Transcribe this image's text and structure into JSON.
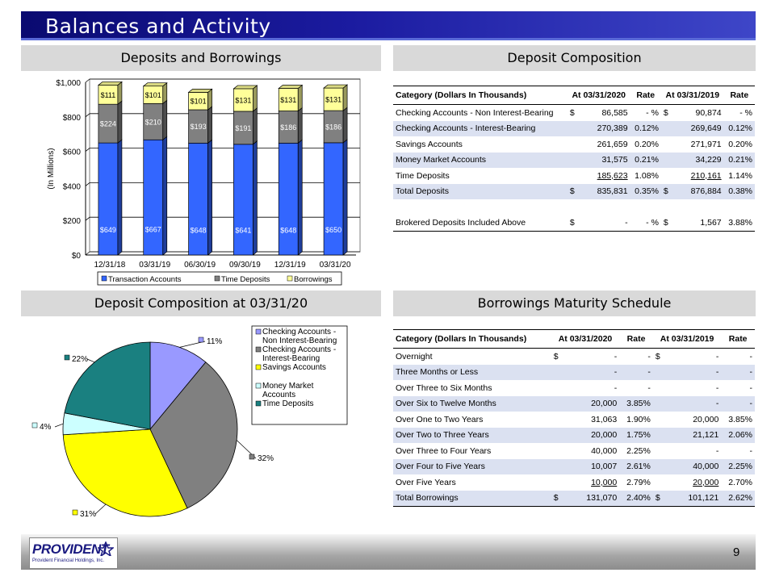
{
  "page": {
    "title": "Balances and Activity",
    "page_number": "9",
    "logo_text": "PROVIDENT",
    "logo_subtext": "Provident Financial Holdings, Inc."
  },
  "sections": {
    "deposits_borrowings": "Deposits and Borrowings",
    "deposit_composition": "Deposit Composition",
    "deposit_composition_pie": "Deposit Composition at 03/31/20",
    "borrowings_schedule": "Borrowings Maturity Schedule"
  },
  "chart_data": [
    {
      "type": "bar",
      "stacked": true,
      "categories": [
        "12/31/18",
        "03/31/19",
        "06/30/19",
        "09/30/19",
        "12/31/19",
        "03/31/20"
      ],
      "series": [
        {
          "name": "Transaction Accounts",
          "values": [
            649,
            667,
            648,
            641,
            648,
            650
          ],
          "labels": [
            "$649",
            "$667",
            "$648",
            "$641",
            "$648",
            "$650"
          ],
          "color": "#3366ff"
        },
        {
          "name": "Time Deposits",
          "values": [
            224,
            210,
            193,
            191,
            186,
            186
          ],
          "labels": [
            "$224",
            "$210",
            "$193",
            "$191",
            "$186",
            "$186"
          ],
          "color": "#808080"
        },
        {
          "name": "Borrowings",
          "values": [
            111,
            101,
            101,
            131,
            131,
            131
          ],
          "labels": [
            "$111",
            "$101",
            "$101",
            "$131",
            "$131",
            "$131"
          ],
          "color": "#ffff99"
        }
      ],
      "ylabel": "(In Millions)",
      "ylim": [
        0,
        1000
      ],
      "yticks": [
        "$0",
        "$200",
        "$400",
        "$600",
        "$800",
        "$1,000"
      ],
      "grid": true,
      "legend": "bottom"
    },
    {
      "type": "pie",
      "slices": [
        {
          "name": "Checking Accounts - Non Interest-Bearing",
          "legend_lines": [
            "Checking Accounts -",
            "Non Interest-Bearing"
          ],
          "value": 11,
          "label": "11%",
          "color": "#9999ff"
        },
        {
          "name": "Checking Accounts - Interest-Bearing",
          "legend_lines": [
            "Checking Accounts -",
            "Interest-Bearing"
          ],
          "value": 32,
          "label": "32%",
          "color": "#808080"
        },
        {
          "name": "Savings Accounts",
          "legend_lines": [
            "Savings Accounts"
          ],
          "value": 31,
          "label": "31%",
          "color": "#ffff00"
        },
        {
          "name": "Money Market Accounts",
          "legend_lines": [
            "Money Market",
            "Accounts"
          ],
          "value": 4,
          "label": "4%",
          "color": "#ccffff"
        },
        {
          "name": "Time Deposits",
          "legend_lines": [
            "Time Deposits"
          ],
          "value": 22,
          "label": "22%",
          "color": "#1a8080"
        }
      ],
      "legend": "right"
    }
  ],
  "deposit_table": {
    "headers": [
      "Category (Dollars In Thousands)",
      "At 03/31/2020",
      "Rate",
      "At 03/31/2019",
      "Rate"
    ],
    "rows": [
      {
        "cat": "Checking Accounts - Non Interest-Bearing",
        "c1": "$",
        "v1": "86,585",
        "r1": "- %",
        "c2": "$",
        "v2": "90,874",
        "r2": "- %"
      },
      {
        "cat": "Checking Accounts - Interest-Bearing",
        "c1": "",
        "v1": "270,389",
        "r1": "0.12%",
        "c2": "",
        "v2": "269,649",
        "r2": "0.12%"
      },
      {
        "cat": "Savings Accounts",
        "c1": "",
        "v1": "261,659",
        "r1": "0.20%",
        "c2": "",
        "v2": "271,971",
        "r2": "0.20%"
      },
      {
        "cat": "Money Market Accounts",
        "c1": "",
        "v1": "31,575",
        "r1": "0.21%",
        "c2": "",
        "v2": "34,229",
        "r2": "0.21%"
      },
      {
        "cat": "Time Deposits",
        "c1": "",
        "v1": "185,623",
        "r1": "1.08%",
        "c2": "",
        "v2": "210,161",
        "r2": "1.14%"
      },
      {
        "cat": "Total Deposits",
        "c1": "$",
        "v1": "835,831",
        "r1": "0.35%",
        "c2": "$",
        "v2": "876,884",
        "r2": "0.38%"
      },
      {
        "cat": "",
        "c1": "",
        "v1": "",
        "r1": "",
        "c2": "",
        "v2": "",
        "r2": ""
      },
      {
        "cat": "Brokered Deposits Included Above",
        "c1": "$",
        "v1": "-",
        "r1": "- %",
        "c2": "$",
        "v2": "1,567",
        "r2": "3.88%"
      }
    ]
  },
  "borrowings_table": {
    "headers": [
      "Category (Dollars In Thousands)",
      "At 03/31/2020",
      "Rate",
      "At 03/31/2019",
      "Rate"
    ],
    "rows": [
      {
        "cat": "Overnight",
        "c1": "$",
        "v1": "-",
        "r1": "-",
        "c2": "$",
        "v2": "-",
        "r2": "-"
      },
      {
        "cat": "Three Months or Less",
        "c1": "",
        "v1": "-",
        "r1": "-",
        "c2": "",
        "v2": "-",
        "r2": "-"
      },
      {
        "cat": "Over Three to Six Months",
        "c1": "",
        "v1": "-",
        "r1": "-",
        "c2": "",
        "v2": "-",
        "r2": "-"
      },
      {
        "cat": "Over Six to Twelve Months",
        "c1": "",
        "v1": "20,000",
        "r1": "3.85%",
        "c2": "",
        "v2": "-",
        "r2": "-"
      },
      {
        "cat": "Over One to Two Years",
        "c1": "",
        "v1": "31,063",
        "r1": "1.90%",
        "c2": "",
        "v2": "20,000",
        "r2": "3.85%"
      },
      {
        "cat": "Over Two to Three Years",
        "c1": "",
        "v1": "20,000",
        "r1": "1.75%",
        "c2": "",
        "v2": "21,121",
        "r2": "2.06%"
      },
      {
        "cat": "Over Three to Four Years",
        "c1": "",
        "v1": "40,000",
        "r1": "2.25%",
        "c2": "",
        "v2": "-",
        "r2": "-"
      },
      {
        "cat": "Over Four to Five Years",
        "c1": "",
        "v1": "10,007",
        "r1": "2.61%",
        "c2": "",
        "v2": "40,000",
        "r2": "2.25%"
      },
      {
        "cat": "Over Five Years",
        "c1": "",
        "v1": "10,000",
        "r1": "2.79%",
        "c2": "",
        "v2": "20,000",
        "r2": "2.70%"
      },
      {
        "cat": "Total Borrowings",
        "c1": "$",
        "v1": "131,070",
        "r1": "2.40%",
        "c2": "$",
        "v2": "101,121",
        "r2": "2.62%"
      }
    ]
  }
}
